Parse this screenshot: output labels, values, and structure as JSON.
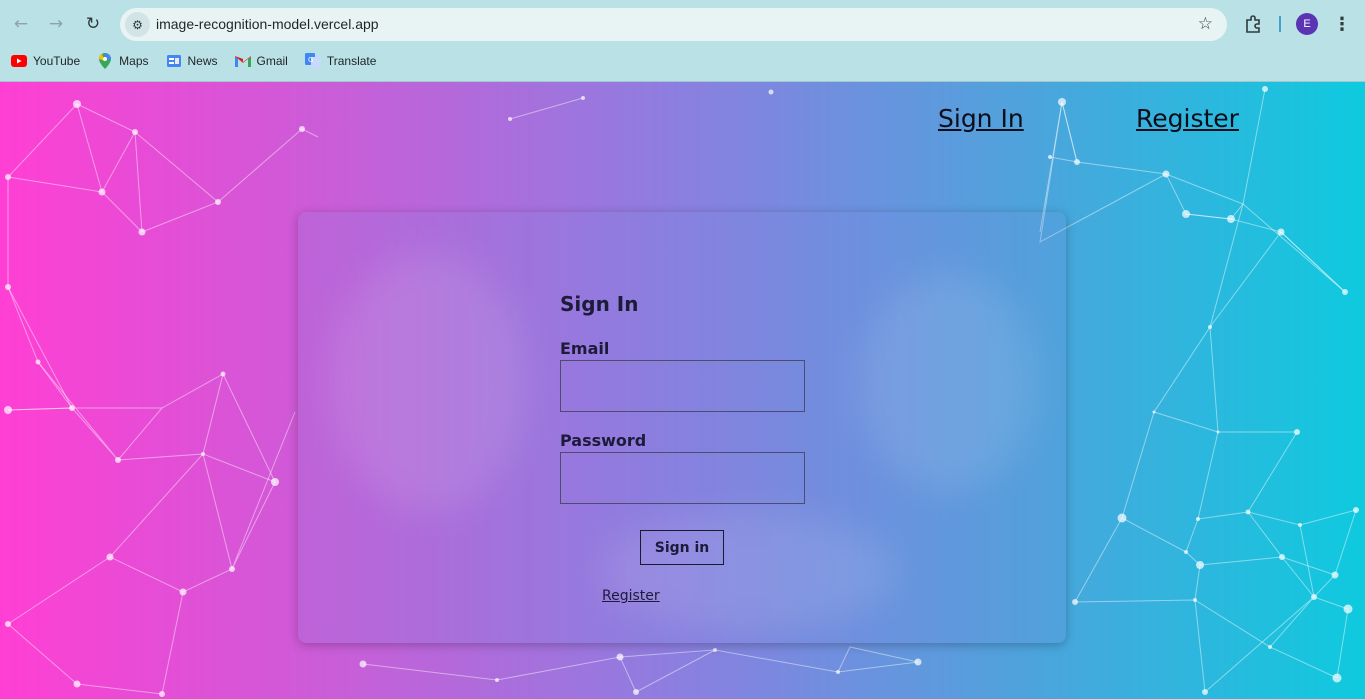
{
  "browser": {
    "url": "image-recognition-model.vercel.app",
    "profile_initial": "E",
    "bookmarks": [
      {
        "label": "YouTube",
        "icon": "youtube-icon"
      },
      {
        "label": "Maps",
        "icon": "maps-icon"
      },
      {
        "label": "News",
        "icon": "news-icon"
      },
      {
        "label": "Gmail",
        "icon": "gmail-icon"
      },
      {
        "label": "Translate",
        "icon": "translate-icon"
      }
    ]
  },
  "nav": {
    "signin_label": "Sign In",
    "register_label": "Register"
  },
  "form": {
    "title": "Sign In",
    "email_label": "Email",
    "email_value": "",
    "password_label": "Password",
    "password_value": "",
    "submit_label": "Sign in",
    "register_link": "Register"
  },
  "colors": {
    "gradient_start": "#ff3fd4",
    "gradient_end": "#0ecadf",
    "text_dark": "#1d1b3a"
  }
}
